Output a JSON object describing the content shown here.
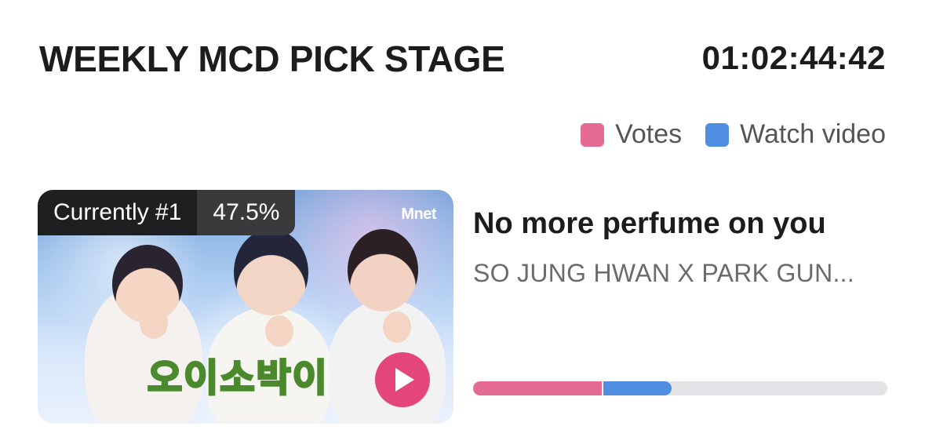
{
  "header": {
    "title": "WEEKLY MCD PICK STAGE",
    "countdown": "01:02:44:42"
  },
  "legend": {
    "items": [
      {
        "label": "Votes",
        "color": "#e56b95"
      },
      {
        "label": "Watch video",
        "color": "#4f8de0"
      }
    ]
  },
  "entry": {
    "rank_label": "Currently #1",
    "rank_percent": "47.5%",
    "thumbnail_logo": "Mnet",
    "thumbnail_caption": "오이소박이",
    "song_title": "No more perfume on you",
    "artist": "SO JUNG HWAN X PARK GUN...",
    "progress": {
      "votes_fraction": 0.31,
      "video_fraction": 0.165
    }
  },
  "colors": {
    "accent_pink": "#e56b95",
    "accent_blue": "#4f8de0",
    "play_button": "#e5467a",
    "track": "#e3e3e6"
  },
  "icons": {
    "play": "play-icon"
  }
}
